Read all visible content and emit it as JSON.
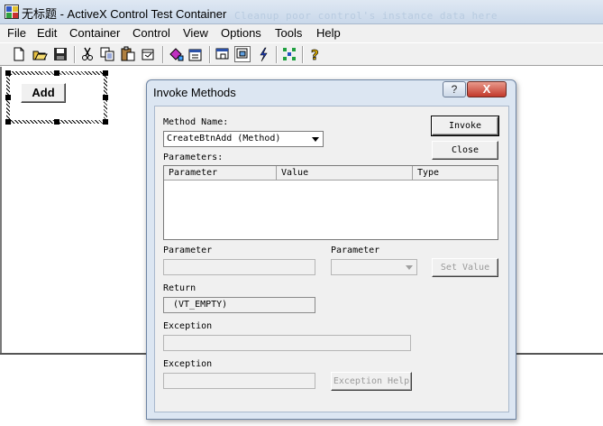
{
  "window": {
    "title": "无标题 - ActiveX Control Test Container",
    "ghost_text": "Cleanup poor control's instance data here"
  },
  "menu": [
    "File",
    "Edit",
    "Container",
    "Control",
    "View",
    "Options",
    "Tools",
    "Help"
  ],
  "toolbar": {
    "buttons": [
      "new-icon",
      "open-icon",
      "save-icon",
      "cut-icon",
      "copy-icon",
      "paste-icon",
      "insert-control-icon",
      "properties-icon",
      "invoke-methods-icon",
      "design-mode-icon",
      "events-icon",
      "ambient-icon",
      "help-icon"
    ]
  },
  "control": {
    "button_label": "Add"
  },
  "dialog": {
    "title": "Invoke Methods",
    "help_glyph": "?",
    "close_glyph": "X",
    "method_name_label": "Method Name:",
    "method_name_value": "CreateBtnAdd (Method)",
    "invoke_label": "Invoke",
    "close_label": "Close",
    "parameters_label": "Parameters:",
    "columns": [
      "Parameter",
      "Value",
      "Type"
    ],
    "parameter_value_label": "Parameter",
    "parameter_type_label": "Parameter",
    "set_value_label": "Set Value",
    "return_label": "Return",
    "return_value": "(VT_EMPTY)",
    "exception_label_1": "Exception",
    "exception_label_2": "Exception",
    "exception_help_label": "Exception Help"
  }
}
